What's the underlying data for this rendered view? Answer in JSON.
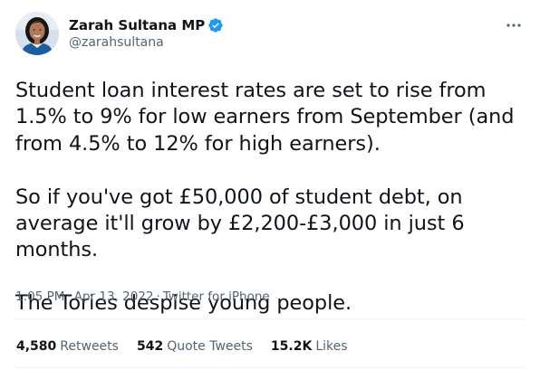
{
  "author": {
    "display_name": "Zarah Sultana MP",
    "handle": "@zarahsultana",
    "verified_icon": "verified-badge-icon",
    "accent_color": "#1d9bf0"
  },
  "tweet": {
    "paragraphs": [
      "Student loan interest rates are set to rise from 1.5% to 9% for low earners from September (and from 4.5% to 12% for high earners).",
      "So if you've got £50,000 of student debt, on average it'll grow by £2,200-£3,000 in just 6 months.",
      "The Tories despise young people."
    ],
    "time": "1:05 PM",
    "separator": "·",
    "date": "Apr 13, 2022",
    "source": "Twitter for iPhone"
  },
  "stats": {
    "retweets": {
      "count": "4,580",
      "label": "Retweets"
    },
    "quotes": {
      "count": "542",
      "label": "Quote Tweets"
    },
    "likes": {
      "count": "15.2K",
      "label": "Likes"
    }
  },
  "icons": {
    "more": "more-options-icon",
    "avatar": "avatar"
  }
}
